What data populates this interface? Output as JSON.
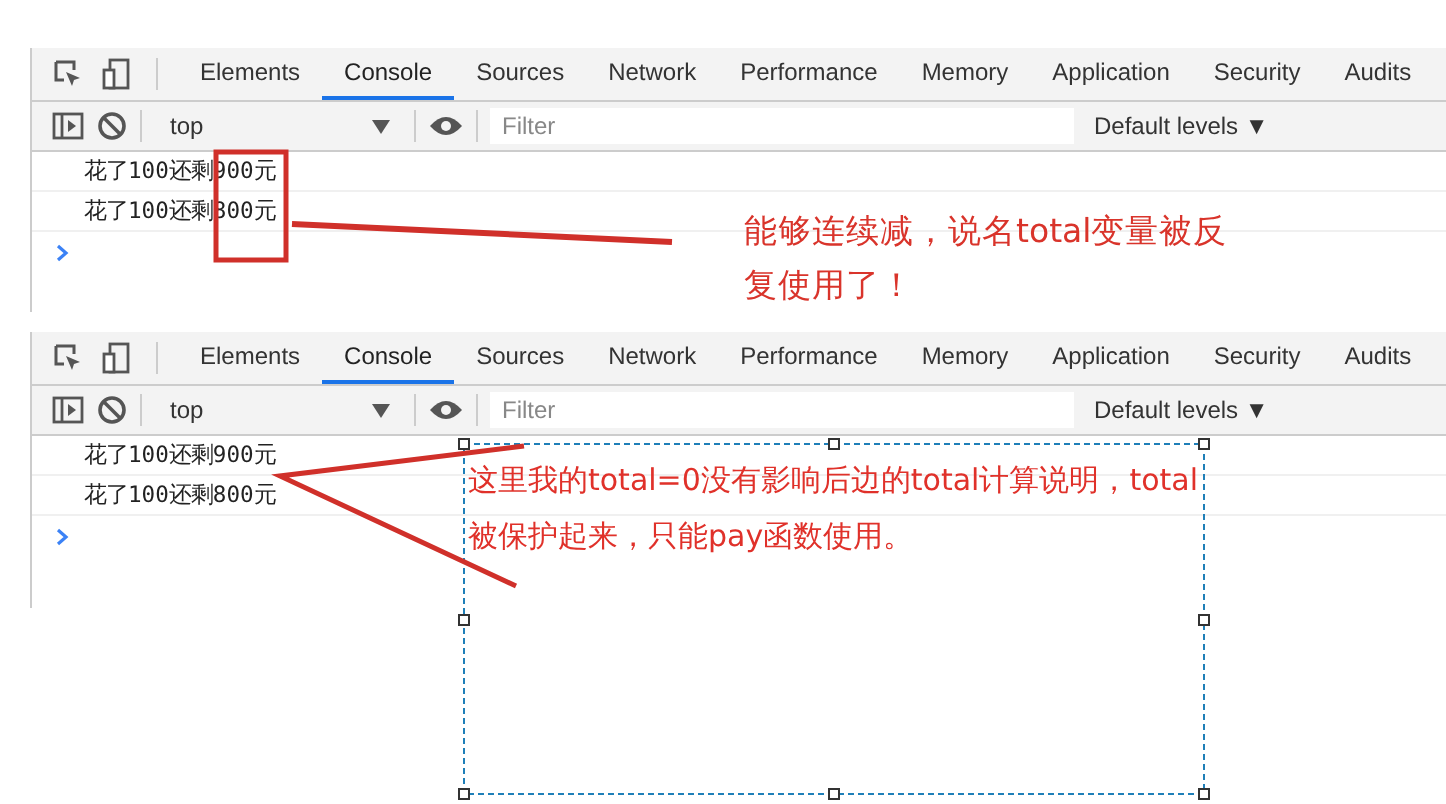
{
  "panels": [
    {
      "tabs": [
        {
          "label": "Elements",
          "selected": false
        },
        {
          "label": "Console",
          "selected": true
        },
        {
          "label": "Sources",
          "selected": false
        },
        {
          "label": "Network",
          "selected": false
        },
        {
          "label": "Performance",
          "selected": false
        },
        {
          "label": "Memory",
          "selected": false
        },
        {
          "label": "Application",
          "selected": false
        },
        {
          "label": "Security",
          "selected": false
        },
        {
          "label": "Audits",
          "selected": false
        }
      ],
      "context": "top",
      "filter": {
        "placeholder": "Filter"
      },
      "levels": "Default levels ▼",
      "log": [
        "花了100还剩900元",
        "花了100还剩800元"
      ],
      "note": {
        "kind": "highlight-box",
        "lines": [
          "能够连续减，说名total变量被反",
          "复使用了！"
        ]
      }
    },
    {
      "tabs": [
        {
          "label": "Elements",
          "selected": false
        },
        {
          "label": "Console",
          "selected": true
        },
        {
          "label": "Sources",
          "selected": false
        },
        {
          "label": "Network",
          "selected": false
        },
        {
          "label": "Performance",
          "selected": false
        },
        {
          "label": "Memory",
          "selected": false
        },
        {
          "label": "Application",
          "selected": false
        },
        {
          "label": "Security",
          "selected": false
        },
        {
          "label": "Audits",
          "selected": false
        }
      ],
      "context": "top",
      "filter": {
        "placeholder": "Filter"
      },
      "levels": "Default levels ▼",
      "log": [
        "花了100还剩900元",
        "花了100还剩800元"
      ],
      "note": {
        "kind": "selection-box",
        "lines": [
          "这里我的total=0没有影响后边的total计算说明，total",
          "被保护起来，只能pay函数使用。"
        ]
      }
    }
  ]
}
